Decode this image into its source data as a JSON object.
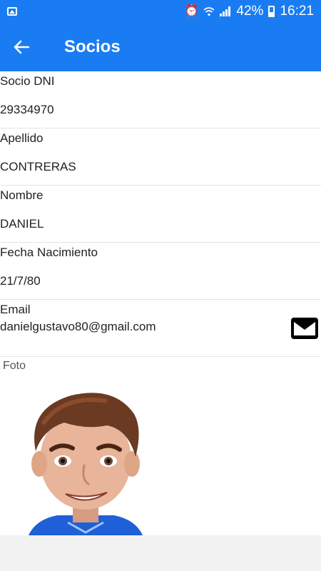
{
  "status_bar": {
    "battery": "42%",
    "time": "16:21",
    "icons": [
      "gallery-icon",
      "alarm-icon",
      "wifi-icon",
      "signal-icon",
      "battery-icon"
    ]
  },
  "app_bar": {
    "title": "Socios",
    "back_icon": "arrow-left-icon"
  },
  "fields": {
    "dni": {
      "label": "Socio DNI",
      "value": "29334970"
    },
    "apellido": {
      "label": "Apellido",
      "value": "CONTRERAS"
    },
    "nombre": {
      "label": "Nombre",
      "value": "DANIEL"
    },
    "nacimiento": {
      "label": "Fecha Nacimiento",
      "value": "21/7/80"
    },
    "email": {
      "label": "Email",
      "value": "danielgustavo80@gmail.com",
      "action_icon": "mail-icon"
    }
  },
  "foto": {
    "label": "Foto",
    "image": "avatar-cartoon-man"
  },
  "colors": {
    "primary": "#1a7cf2",
    "background": "#f2f2f2",
    "surface": "#ffffff"
  }
}
